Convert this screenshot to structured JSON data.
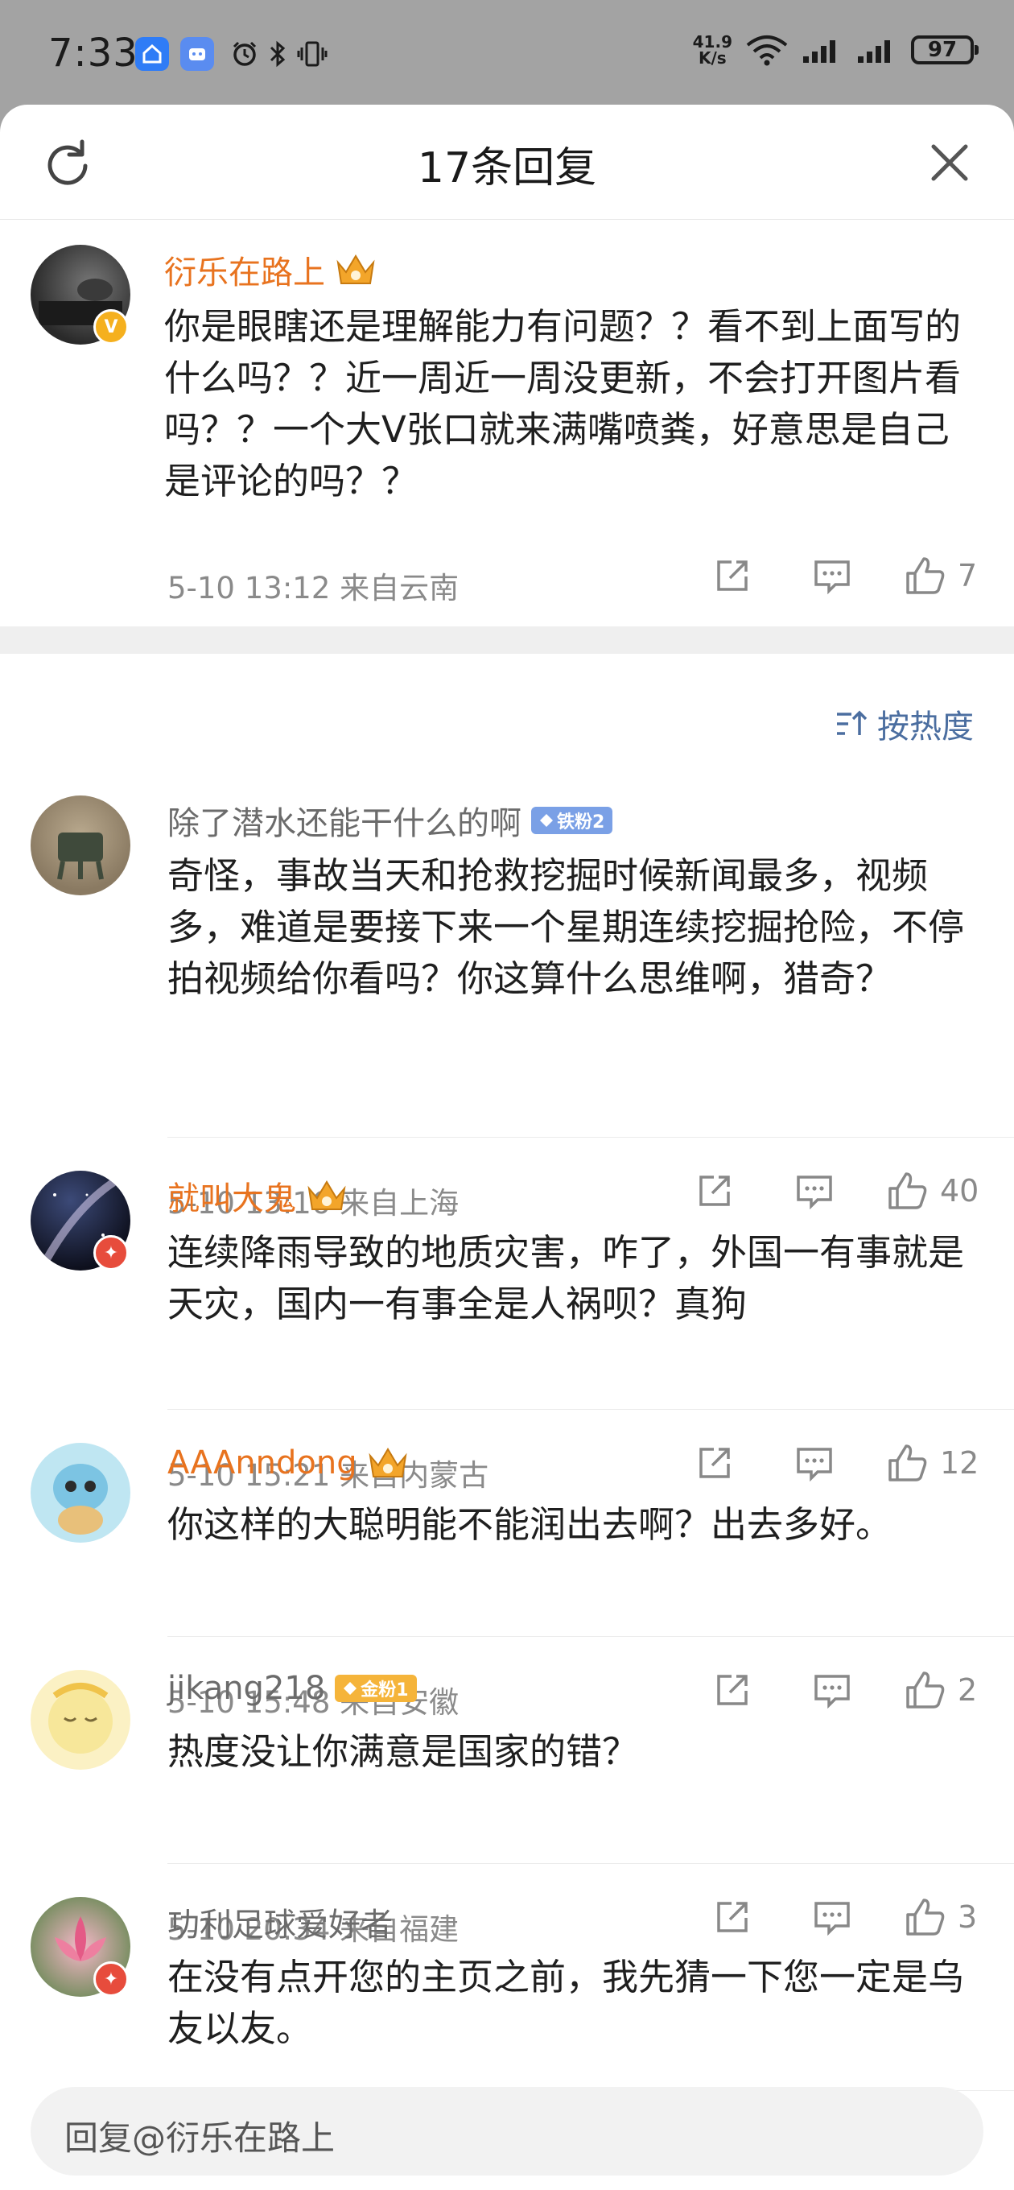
{
  "status_bar": {
    "time": "7:33",
    "net_speed_value": "41.9",
    "net_speed_unit": "K/s",
    "battery": "97",
    "app_icons": [
      "home-app-icon",
      "bot-app-icon"
    ],
    "system_icons": [
      "alarm-icon",
      "bluetooth-icon",
      "vibrate-icon",
      "wifi-icon",
      "signal-icon",
      "signal-icon"
    ]
  },
  "header": {
    "title": "17条回复",
    "refresh_icon": "refresh-icon",
    "close_icon": "close-icon"
  },
  "root_comment": {
    "username": "衍乐在路上",
    "text": "你是眼瞎还是理解能力有问题？？看不到上面写的什么吗？？近一周近一周没更新，不会打开图片看吗？？一个大V张口就来满嘴喷粪，好意思是自己是评论的吗？？",
    "meta": "5-10 13:12  来自云南",
    "likes": "7",
    "badge": "V"
  },
  "sort": {
    "label": "按热度"
  },
  "replies": [
    {
      "username": "除了潜水还能干什么的啊",
      "fan_badge": "铁粉2",
      "text": "奇怪，事故当天和抢救挖掘时候新闻最多，视频多，难道是要接下来一个星期连续挖掘抢险，不停拍视频给你看吗？你这算什么思维啊，猎奇？",
      "meta": "5-10 13:16  来自上海",
      "likes": "40"
    },
    {
      "username": "就叫大鬼",
      "text": "连续降雨导致的地质灾害，咋了，外国一有事就是天灾，国内一有事全是人祸呗？真狗",
      "meta": "5-10 15:21  来自内蒙古",
      "likes": "12"
    },
    {
      "username": "AAAnndong",
      "text": "你这样的大聪明能不能润出去啊？出去多好。",
      "meta": "5-10 15:48  来自安徽",
      "likes": "2"
    },
    {
      "username": "jikang218",
      "fan_badge": "金粉1",
      "text": "热度没让你满意是国家的错？",
      "meta": "5-10 20:34  来自福建",
      "likes": "3"
    },
    {
      "username": "功利足球爱好者",
      "text": "在没有点开您的主页之前，我先猜一下您一定是乌友以友。"
    }
  ],
  "reply_input": {
    "placeholder": "回复@衍乐在路上"
  },
  "colors": {
    "accent_orange": "#e8731f",
    "sort_blue": "#4b6ea0",
    "status_bar_bg": "#a3a3a3"
  }
}
